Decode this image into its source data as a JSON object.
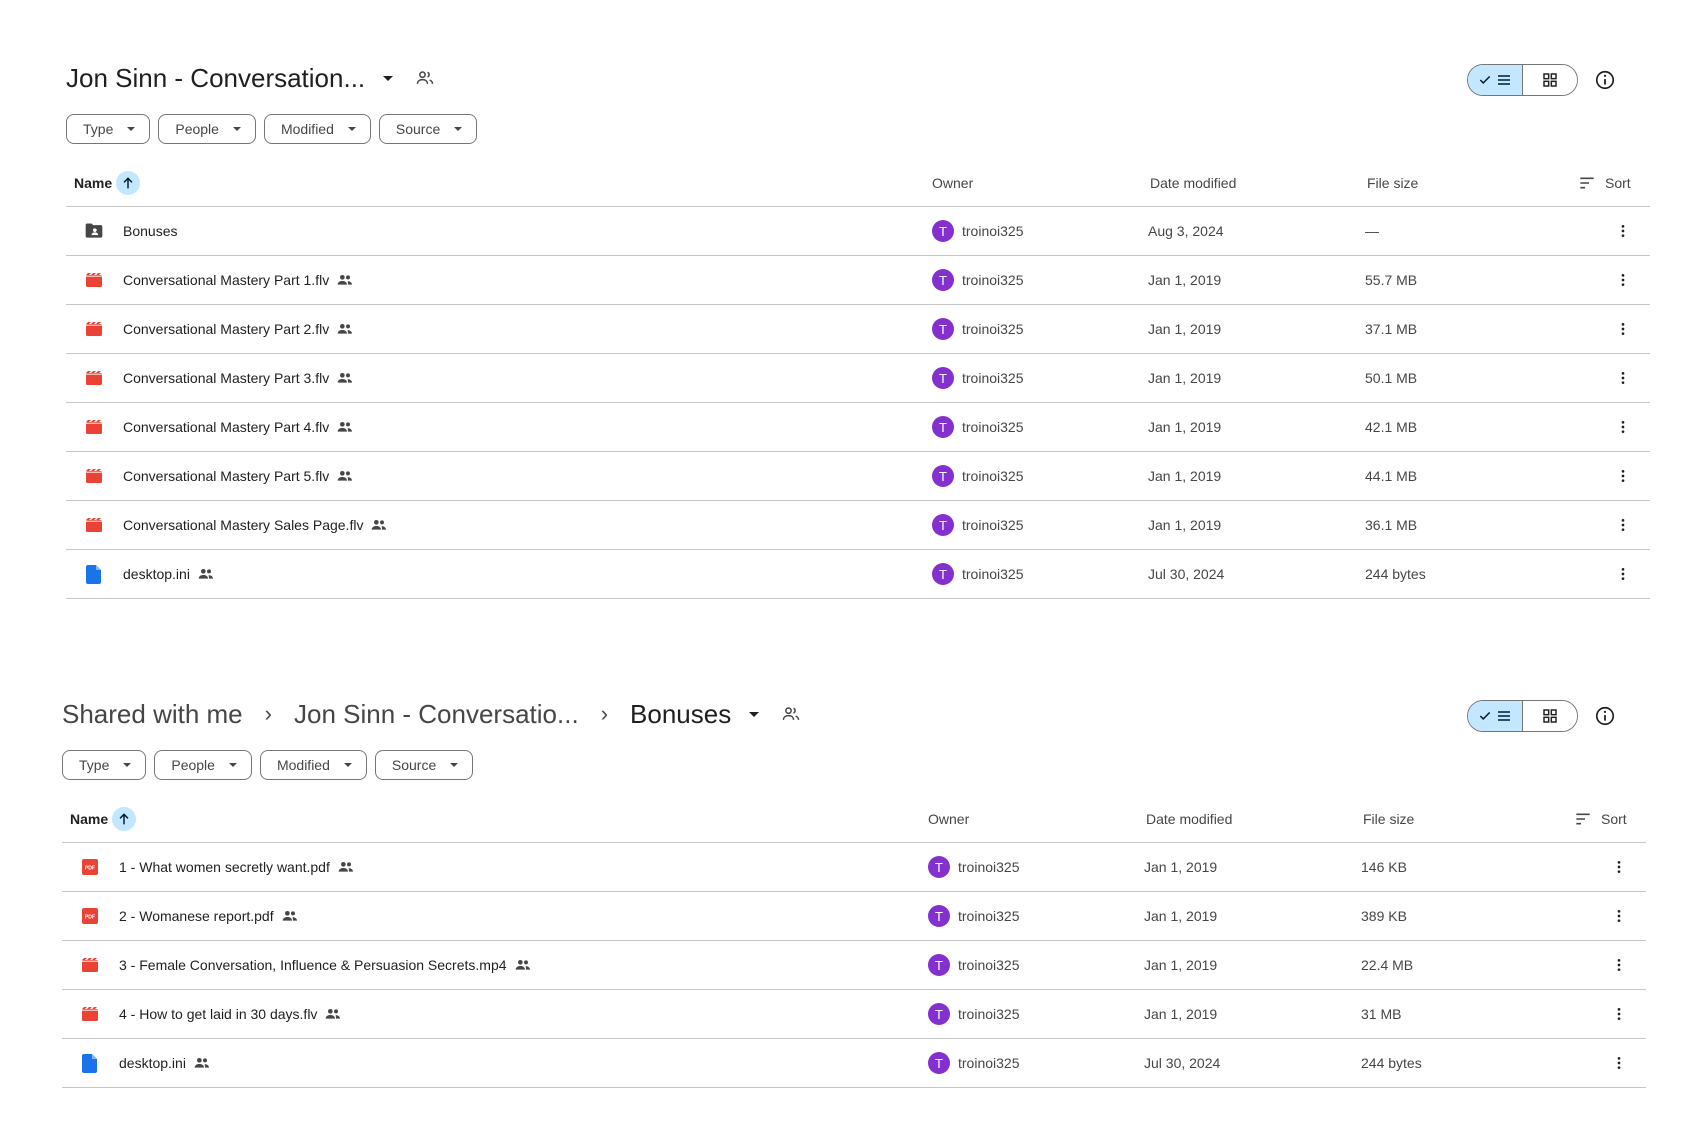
{
  "colors": {
    "accent_bg": "#c2e7ff",
    "avatar": "#8430ce",
    "video_icon": "#ea4335",
    "pdf_icon": "#ea4335",
    "doc_icon": "#1a73e8",
    "folder_icon": "#444746"
  },
  "panel1": {
    "title": "Jon Sinn - Conversation...",
    "filters": [
      "Type",
      "People",
      "Modified",
      "Source"
    ],
    "columns": {
      "name": "Name",
      "owner": "Owner",
      "date": "Date modified",
      "size": "File size",
      "sort": "Sort"
    },
    "rows": [
      {
        "icon": "folder-icon",
        "name": "Bonuses",
        "shared": false,
        "owner": "troinoi325",
        "owner_initial": "T",
        "date": "Aug 3, 2024",
        "size": "—"
      },
      {
        "icon": "video-icon",
        "name": "Conversational Mastery Part 1.flv",
        "shared": true,
        "owner": "troinoi325",
        "owner_initial": "T",
        "date": "Jan 1, 2019",
        "size": "55.7 MB"
      },
      {
        "icon": "video-icon",
        "name": "Conversational Mastery Part 2.flv",
        "shared": true,
        "owner": "troinoi325",
        "owner_initial": "T",
        "date": "Jan 1, 2019",
        "size": "37.1 MB"
      },
      {
        "icon": "video-icon",
        "name": "Conversational Mastery Part 3.flv",
        "shared": true,
        "owner": "troinoi325",
        "owner_initial": "T",
        "date": "Jan 1, 2019",
        "size": "50.1 MB"
      },
      {
        "icon": "video-icon",
        "name": "Conversational Mastery Part 4.flv",
        "shared": true,
        "owner": "troinoi325",
        "owner_initial": "T",
        "date": "Jan 1, 2019",
        "size": "42.1 MB"
      },
      {
        "icon": "video-icon",
        "name": "Conversational Mastery Part 5.flv",
        "shared": true,
        "owner": "troinoi325",
        "owner_initial": "T",
        "date": "Jan 1, 2019",
        "size": "44.1 MB"
      },
      {
        "icon": "video-icon",
        "name": "Conversational Mastery Sales Page.flv",
        "shared": true,
        "owner": "troinoi325",
        "owner_initial": "T",
        "date": "Jan 1, 2019",
        "size": "36.1 MB"
      },
      {
        "icon": "doc-icon",
        "name": "desktop.ini",
        "shared": true,
        "owner": "troinoi325",
        "owner_initial": "T",
        "date": "Jul 30, 2024",
        "size": "244 bytes"
      }
    ]
  },
  "panel2": {
    "breadcrumb": [
      "Shared with me",
      "Jon Sinn - Conversatio...",
      "Bonuses"
    ],
    "filters": [
      "Type",
      "People",
      "Modified",
      "Source"
    ],
    "columns": {
      "name": "Name",
      "owner": "Owner",
      "date": "Date modified",
      "size": "File size",
      "sort": "Sort"
    },
    "rows": [
      {
        "icon": "pdf-icon",
        "name": "1 - What women secretly want.pdf",
        "shared": true,
        "owner": "troinoi325",
        "owner_initial": "T",
        "date": "Jan 1, 2019",
        "size": "146 KB"
      },
      {
        "icon": "pdf-icon",
        "name": "2 - Womanese report.pdf",
        "shared": true,
        "owner": "troinoi325",
        "owner_initial": "T",
        "date": "Jan 1, 2019",
        "size": "389 KB"
      },
      {
        "icon": "video-icon",
        "name": "3 - Female Conversation, Influence & Persuasion Secrets.mp4",
        "shared": true,
        "owner": "troinoi325",
        "owner_initial": "T",
        "date": "Jan 1, 2019",
        "size": "22.4 MB"
      },
      {
        "icon": "video-icon",
        "name": "4 - How to get laid in 30 days.flv",
        "shared": true,
        "owner": "troinoi325",
        "owner_initial": "T",
        "date": "Jan 1, 2019",
        "size": "31 MB"
      },
      {
        "icon": "doc-icon",
        "name": "desktop.ini",
        "shared": true,
        "owner": "troinoi325",
        "owner_initial": "T",
        "date": "Jul 30, 2024",
        "size": "244 bytes"
      }
    ]
  }
}
